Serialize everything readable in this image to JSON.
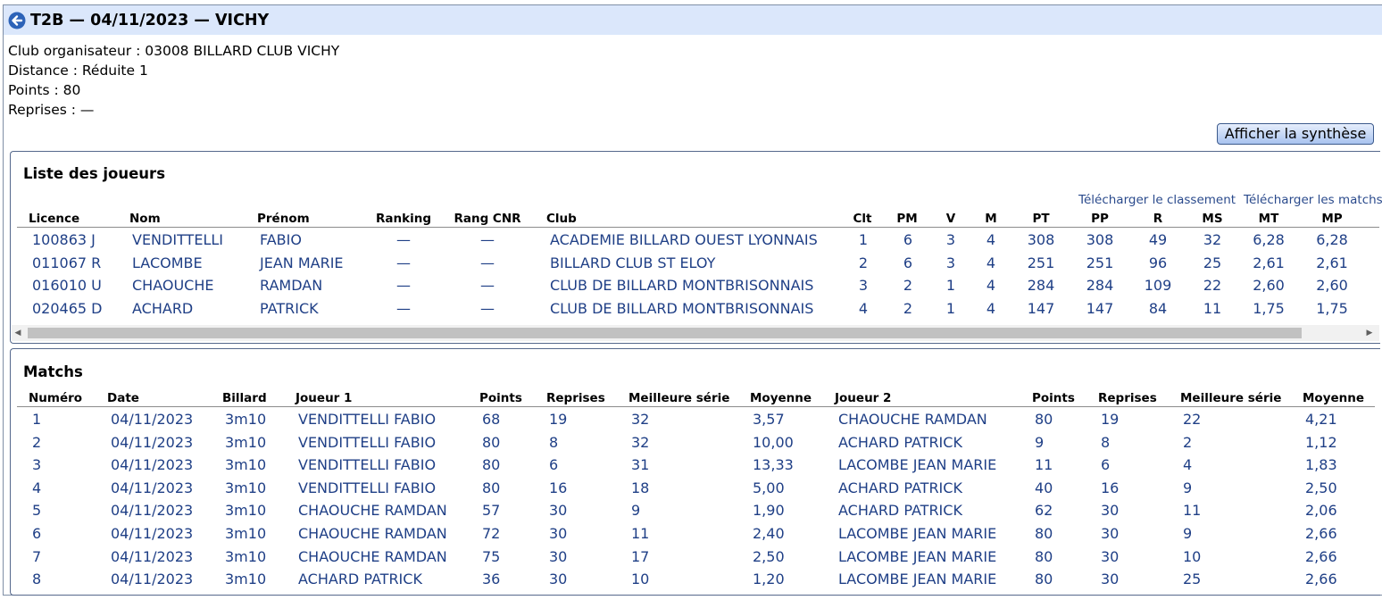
{
  "header": {
    "title": "T2B — 04/11/2023 — VICHY"
  },
  "info": [
    "Club organisateur : 03008 BILLARD CLUB VICHY",
    "Distance : Réduite 1",
    "Points : 80",
    "Reprises : —"
  ],
  "synthese_button": "Afficher la synthèse",
  "players": {
    "title": "Liste des joueurs",
    "download_ranking": "Télécharger le classement",
    "download_matches": "Télécharger les matchs",
    "columns": [
      "Licence",
      "Nom",
      "Prénom",
      "Ranking",
      "Rang CNR",
      "Club",
      "Clt",
      "PM",
      "V",
      "M",
      "PT",
      "PP",
      "R",
      "MS",
      "MT",
      "MP"
    ],
    "rows": [
      [
        "100863 J",
        "VENDITTELLI",
        "FABIO",
        "—",
        "—",
        "ACADEMIE BILLARD OUEST LYONNAIS",
        "1",
        "6",
        "3",
        "4",
        "308",
        "308",
        "49",
        "32",
        "6,28",
        "6,28"
      ],
      [
        "011067 R",
        "LACOMBE",
        "JEAN MARIE",
        "—",
        "—",
        "BILLARD CLUB ST ELOY",
        "2",
        "6",
        "3",
        "4",
        "251",
        "251",
        "96",
        "25",
        "2,61",
        "2,61"
      ],
      [
        "016010 U",
        "CHAOUCHE",
        "RAMDAN",
        "—",
        "—",
        "CLUB DE BILLARD MONTBRISONNAIS",
        "3",
        "2",
        "1",
        "4",
        "284",
        "284",
        "109",
        "22",
        "2,60",
        "2,60"
      ],
      [
        "020465 D",
        "ACHARD",
        "PATRICK",
        "—",
        "—",
        "CLUB DE BILLARD MONTBRISONNAIS",
        "4",
        "2",
        "1",
        "4",
        "147",
        "147",
        "84",
        "11",
        "1,75",
        "1,75"
      ]
    ]
  },
  "matches": {
    "title": "Matchs",
    "columns": [
      "Numéro",
      "Date",
      "Billard",
      "Joueur 1",
      "Points",
      "Reprises",
      "Meilleure série",
      "Moyenne",
      "Joueur 2",
      "Points",
      "Reprises",
      "Meilleure série",
      "Moyenne"
    ],
    "rows": [
      [
        "1",
        "04/11/2023",
        "3m10",
        "VENDITTELLI FABIO",
        "68",
        "19",
        "32",
        "3,57",
        "CHAOUCHE RAMDAN",
        "80",
        "19",
        "22",
        "4,21"
      ],
      [
        "2",
        "04/11/2023",
        "3m10",
        "VENDITTELLI FABIO",
        "80",
        "8",
        "32",
        "10,00",
        "ACHARD PATRICK",
        "9",
        "8",
        "2",
        "1,12"
      ],
      [
        "3",
        "04/11/2023",
        "3m10",
        "VENDITTELLI FABIO",
        "80",
        "6",
        "31",
        "13,33",
        "LACOMBE JEAN MARIE",
        "11",
        "6",
        "4",
        "1,83"
      ],
      [
        "4",
        "04/11/2023",
        "3m10",
        "VENDITTELLI FABIO",
        "80",
        "16",
        "18",
        "5,00",
        "ACHARD PATRICK",
        "40",
        "16",
        "9",
        "2,50"
      ],
      [
        "5",
        "04/11/2023",
        "3m10",
        "CHAOUCHE RAMDAN",
        "57",
        "30",
        "9",
        "1,90",
        "ACHARD PATRICK",
        "62",
        "30",
        "11",
        "2,06"
      ],
      [
        "6",
        "04/11/2023",
        "3m10",
        "CHAOUCHE RAMDAN",
        "72",
        "30",
        "11",
        "2,40",
        "LACOMBE JEAN MARIE",
        "80",
        "30",
        "9",
        "2,66"
      ],
      [
        "7",
        "04/11/2023",
        "3m10",
        "CHAOUCHE RAMDAN",
        "75",
        "30",
        "17",
        "2,50",
        "LACOMBE JEAN MARIE",
        "80",
        "30",
        "10",
        "2,66"
      ],
      [
        "8",
        "04/11/2023",
        "3m10",
        "ACHARD PATRICK",
        "36",
        "30",
        "10",
        "1,20",
        "LACOMBE JEAN MARIE",
        "80",
        "30",
        "25",
        "2,66"
      ]
    ]
  }
}
